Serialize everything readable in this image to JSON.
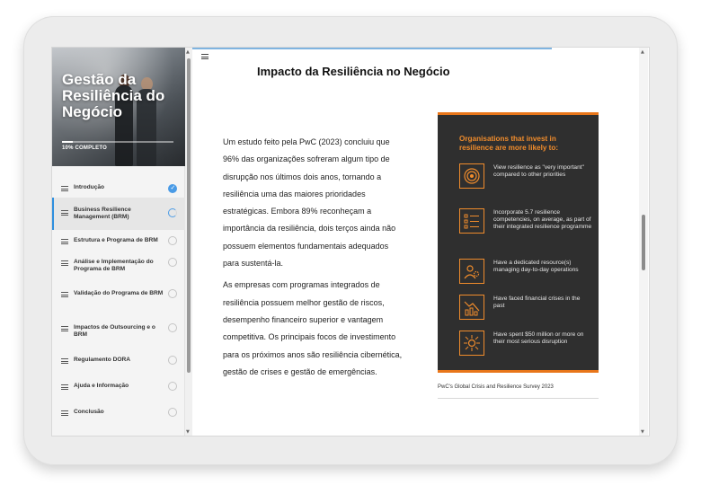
{
  "course": {
    "title": "Gestão da Resiliência do Negócio",
    "progress_label": "10% COMPLETO",
    "progress_fraction": 0.1
  },
  "sidebar": {
    "items": [
      {
        "label": "Introdução",
        "status": "complete"
      },
      {
        "label": "Business Resilience Management (BRM)",
        "status": "in-progress",
        "active": true
      },
      {
        "label": "Estrutura e Programa de BRM",
        "status": "not-started"
      },
      {
        "label": "Análise e Implementação do Programa de BRM",
        "status": "not-started"
      },
      {
        "label": "Validação do Programa de BRM",
        "status": "not-started"
      },
      {
        "label": "Impactos de Outsourcing e o BRM",
        "status": "not-started"
      },
      {
        "label": "Regulamento DORA",
        "status": "not-started"
      },
      {
        "label": "Ajuda e Informação",
        "status": "not-started"
      },
      {
        "label": "Conclusão",
        "status": "not-started"
      }
    ]
  },
  "lesson": {
    "title": "Impacto da Resiliência no Negócio",
    "paragraph_1": "Um estudo feito pela PwC (2023) concluiu que 96% das organizações sofreram algum tipo de disrupção nos últimos dois anos, tornando a resiliência uma das maiores prioridades estratégicas. Embora 89% reconheçam a importância da resiliência, dois terços ainda não possuem elementos fundamentais adequados para sustentá-la.",
    "paragraph_2": "As empresas com programas integrados de resiliência possuem melhor gestão de riscos, desempenho financeiro superior e vantagem competitiva. Os principais focos de investimento para os próximos anos são resiliência cibernética, gestão de crises e gestão de emergências."
  },
  "infographic": {
    "heading": "Organisations that invest in resilience are more likely to:",
    "rows": [
      {
        "icon": "target-icon",
        "text": "View resilience as \"very important\" compared to other priorities"
      },
      {
        "icon": "checklist-icon",
        "text": "Incorporate 5.7 resilience competencies, on average, as part of their integrated resilience programme"
      },
      {
        "icon": "person-gear-icon",
        "text": "Have a dedicated resource(s) managing day-to-day operations"
      },
      {
        "icon": "declining-chart-icon",
        "text": "Have faced financial crises in the past"
      },
      {
        "icon": "money-arrows-icon",
        "text": "Have spent $50 million or more on their most serious disruption"
      }
    ],
    "caption": "PwC's Global Crisis and Resilience Survey 2023",
    "colors": {
      "background": "#2f2f2f",
      "accent": "#f08c2c"
    }
  }
}
